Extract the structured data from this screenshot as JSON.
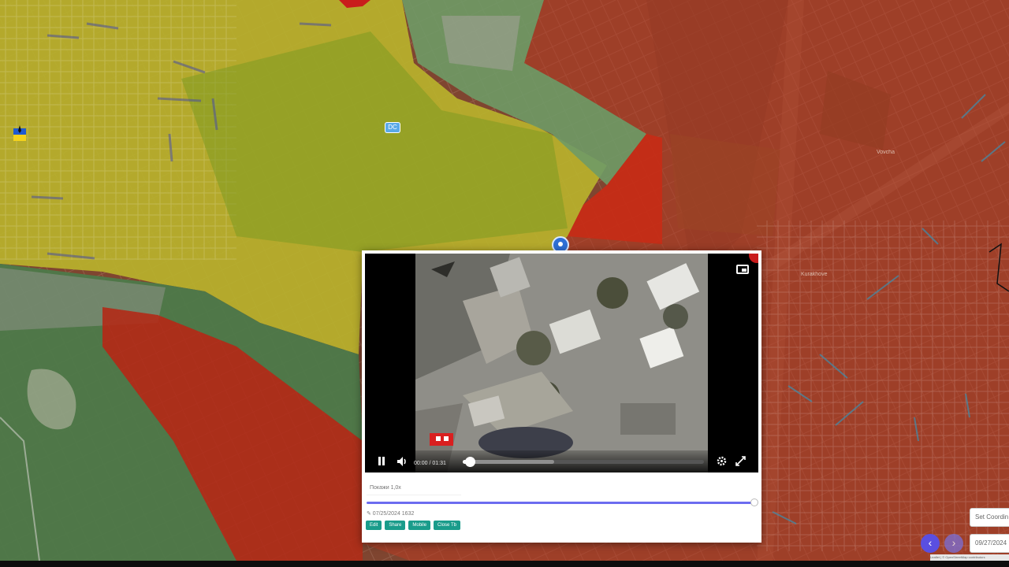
{
  "map": {
    "labels": [
      "Vovcha",
      "Kurakhove"
    ],
    "cluster_badge": "DC",
    "colors": {
      "ukraine_zone": "#c9c23a",
      "contested_zone": "#5f8c5a",
      "russia_zone": "#b8321f",
      "satellite_base": "#7f4530"
    }
  },
  "popup": {
    "video": {
      "time": "00:00 / 01:31",
      "progress_fraction": 0.03,
      "buffered_fraction": 0.38,
      "icons": [
        "pause-icon",
        "volume-icon",
        "gear-icon",
        "fullscreen-icon",
        "pip-icon"
      ]
    },
    "caption_placeholder": "Покажи 1,0x",
    "slider_fraction": 1.0,
    "date_text": "✎ 07/25/2024 1632",
    "actions": [
      "Edit",
      "Share",
      "Mobile",
      "Close Tb"
    ]
  },
  "side_controls": {
    "coord_label": "Set Coordin",
    "date_value": "09/27/2024",
    "prev_label": "‹",
    "next_label": "›",
    "attribution": "Leaflet | © OpenStreetMap contributors"
  }
}
